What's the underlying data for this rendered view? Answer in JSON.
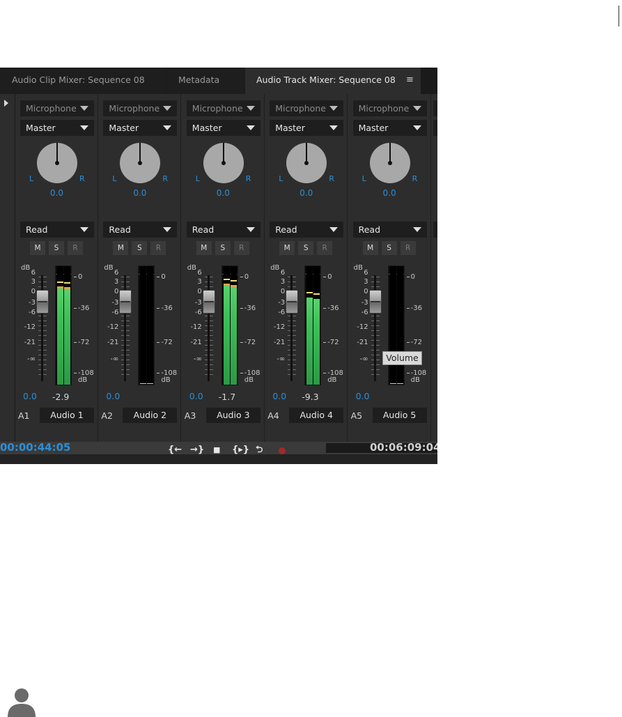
{
  "tabs": [
    {
      "label": "Audio Clip Mixer: Sequence 08",
      "active": false
    },
    {
      "label": "Metadata",
      "active": false
    },
    {
      "label": "Audio Track Mixer: Sequence 08",
      "active": true
    }
  ],
  "tab_menu_icon": "hamburger-menu-icon",
  "tracks": [
    {
      "id": "A1",
      "name": "Audio 1",
      "input": "Microphone",
      "output": "Master",
      "automation": "Read",
      "pan_left": "L",
      "pan_right": "R",
      "pan_value": "0.0",
      "volume": "0.0",
      "peak": "-2.9",
      "meter_fill": 0.9,
      "active": true
    },
    {
      "id": "A2",
      "name": "Audio 2",
      "input": "Microphone",
      "output": "Master",
      "automation": "Read",
      "pan_left": "L",
      "pan_right": "R",
      "pan_value": "0.0",
      "volume": "0.0",
      "peak": "",
      "meter_fill": 0.0,
      "active": false
    },
    {
      "id": "A3",
      "name": "Audio 3",
      "input": "Microphone",
      "output": "Master",
      "automation": "Read",
      "pan_left": "L",
      "pan_right": "R",
      "pan_value": "0.0",
      "volume": "0.0",
      "peak": "-1.7",
      "meter_fill": 0.92,
      "active": true
    },
    {
      "id": "A4",
      "name": "Audio 4",
      "input": "Microphone",
      "output": "Master",
      "automation": "Read",
      "pan_left": "L",
      "pan_right": "R",
      "pan_value": "0.0",
      "volume": "0.0",
      "peak": "-9.3",
      "meter_fill": 0.8,
      "active": true
    },
    {
      "id": "A5",
      "name": "Audio 5",
      "input": "Microphone",
      "output": "Master",
      "automation": "Read",
      "pan_left": "L",
      "pan_right": "R",
      "pan_value": "0.0",
      "volume": "0.0",
      "peak": "",
      "meter_fill": 0.0,
      "active": false
    }
  ],
  "solo_buttons": {
    "mute": "M",
    "solo": "S",
    "record": "R"
  },
  "fader_scale": {
    "title": "dB",
    "ticks": [
      "6",
      "3",
      "0",
      "-3",
      "-6",
      "-12",
      "-21",
      "-∞"
    ]
  },
  "meter_scale": {
    "ticks": [
      "0",
      "-36",
      "-72",
      "-108"
    ],
    "unit": "dB"
  },
  "tooltip": "Volume",
  "transport": {
    "current_time": "00:00:44:05",
    "duration": "00:06:09:04",
    "buttons": [
      {
        "name": "go-to-in-icon",
        "glyph": "{←"
      },
      {
        "name": "go-to-out-icon",
        "glyph": "→}"
      },
      {
        "name": "stop-icon",
        "glyph": "■"
      },
      {
        "name": "play-in-to-out-icon",
        "glyph": "{▸}"
      },
      {
        "name": "loop-icon",
        "glyph": "⮌"
      },
      {
        "name": "record-icon",
        "glyph": "●"
      }
    ]
  },
  "colors": {
    "accent": "#2b8fd6",
    "meter_green": "#3fc05a",
    "record": "#a02a2a"
  }
}
